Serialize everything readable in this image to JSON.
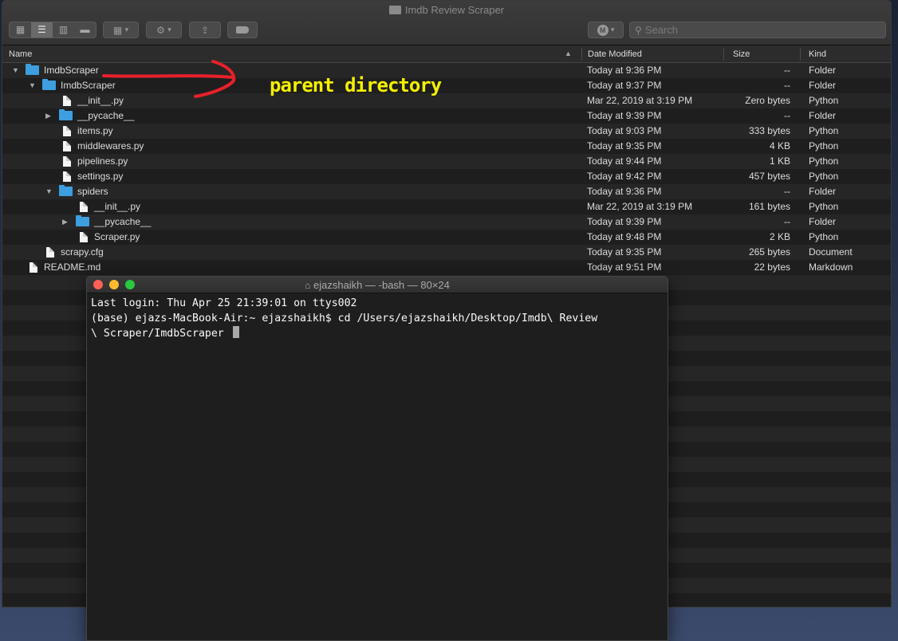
{
  "finder": {
    "title": "Imdb Review Scraper",
    "search_placeholder": "Search",
    "columns": {
      "name": "Name",
      "date": "Date Modified",
      "size": "Size",
      "kind": "Kind"
    },
    "rows": [
      {
        "name": "ImdbScraper",
        "date": "Today at 9:36 PM",
        "size": "--",
        "kind": "Folder",
        "type": "folder",
        "depth": 0,
        "disclosure": "open"
      },
      {
        "name": "ImdbScraper",
        "date": "Today at 9:37 PM",
        "size": "--",
        "kind": "Folder",
        "type": "folder",
        "depth": 1,
        "disclosure": "open"
      },
      {
        "name": "__init__.py",
        "date": "Mar 22, 2019 at 3:19 PM",
        "size": "Zero bytes",
        "kind": "Python",
        "type": "file",
        "depth": 2
      },
      {
        "name": "__pycache__",
        "date": "Today at 9:39 PM",
        "size": "--",
        "kind": "Folder",
        "type": "folder",
        "depth": 2,
        "disclosure": "closed"
      },
      {
        "name": "items.py",
        "date": "Today at 9:03 PM",
        "size": "333 bytes",
        "kind": "Python",
        "type": "file",
        "depth": 2
      },
      {
        "name": "middlewares.py",
        "date": "Today at 9:35 PM",
        "size": "4 KB",
        "kind": "Python",
        "type": "file",
        "depth": 2
      },
      {
        "name": "pipelines.py",
        "date": "Today at 9:44 PM",
        "size": "1 KB",
        "kind": "Python",
        "type": "file",
        "depth": 2
      },
      {
        "name": "settings.py",
        "date": "Today at 9:42 PM",
        "size": "457 bytes",
        "kind": "Python",
        "type": "file",
        "depth": 2
      },
      {
        "name": "spiders",
        "date": "Today at 9:36 PM",
        "size": "--",
        "kind": "Folder",
        "type": "folder",
        "depth": 2,
        "disclosure": "open"
      },
      {
        "name": "__init__.py",
        "date": "Mar 22, 2019 at 3:19 PM",
        "size": "161 bytes",
        "kind": "Python",
        "type": "file",
        "depth": 3
      },
      {
        "name": "__pycache__",
        "date": "Today at 9:39 PM",
        "size": "--",
        "kind": "Folder",
        "type": "folder",
        "depth": 3,
        "disclosure": "closed"
      },
      {
        "name": "Scraper.py",
        "date": "Today at 9:48 PM",
        "size": "2 KB",
        "kind": "Python",
        "type": "file",
        "depth": 3
      },
      {
        "name": "scrapy.cfg",
        "date": "Today at 9:35 PM",
        "size": "265 bytes",
        "kind": "Document",
        "type": "file",
        "depth": 1
      },
      {
        "name": "README.md",
        "date": "Today at 9:51 PM",
        "size": "22 bytes",
        "kind": "Markdown",
        "type": "file",
        "depth": 0
      }
    ],
    "empty_row_count": 22,
    "annotation": "parent directory",
    "annotation_color": "#f4f000",
    "arrow_color": "#e8202a",
    "folder_color": "#3d9ee0"
  },
  "terminal": {
    "title": "ejazshaikh — -bash — 80×24",
    "lines": [
      "Last login: Thu Apr 25 21:39:01 on ttys002",
      "(base) ejazs-MacBook-Air:~ ejazshaikh$ cd /Users/ejazshaikh/Desktop/Imdb\\ Review",
      "\\ Scraper/ImdbScraper "
    ],
    "traffic_colors": [
      "#fe5f57",
      "#febc2e",
      "#28c840"
    ]
  }
}
